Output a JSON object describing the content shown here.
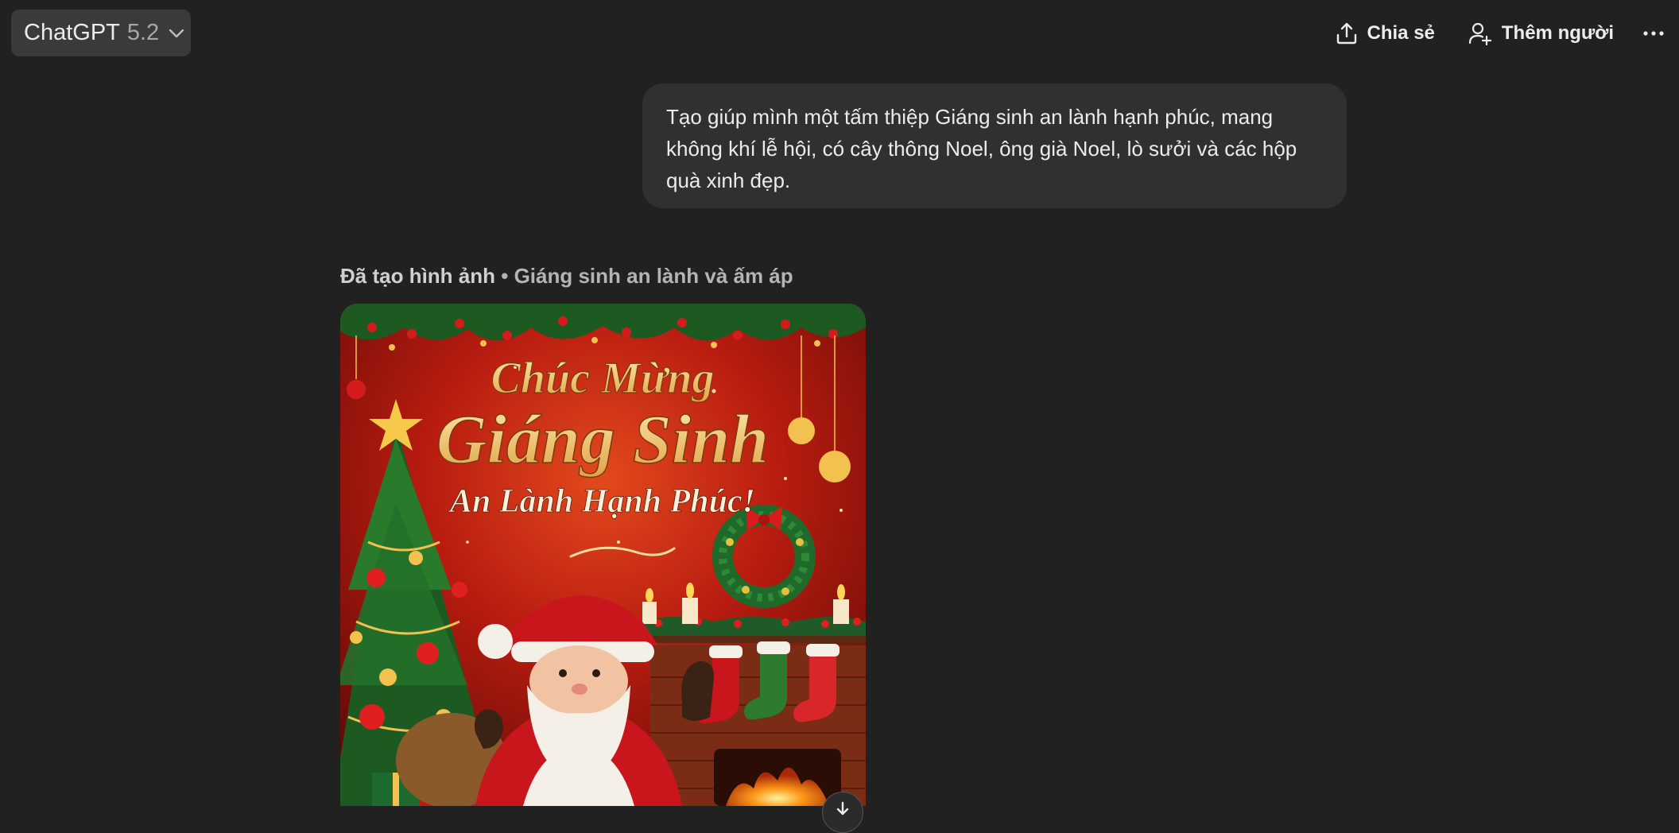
{
  "header": {
    "model_name": "ChatGPT",
    "model_version": "5.2",
    "share_label": "Chia sẻ",
    "add_people_label": "Thêm người"
  },
  "conversation": {
    "user_message": "Tạo giúp mình một tấm thiệp Giáng sinh an lành hạnh phúc, mang không khí lễ hội, có cây thông Noel, ông già Noel, lò sưởi và các hộp quà xinh đẹp.",
    "generated_label": "Đã tạo hình ảnh",
    "generated_separator": " • ",
    "generated_title": "Giáng sinh an lành và ấm áp"
  },
  "card_image": {
    "line1": "Chúc Mừng",
    "line2": "Giáng Sinh",
    "line3": "An Lành Hạnh Phúc!"
  },
  "icons": {
    "model": "chevron-down-icon",
    "share": "share-upload-icon",
    "add_people": "add-person-icon",
    "more": "more-horizontal-icon",
    "download": "download-icon"
  },
  "colors": {
    "background": "#212121",
    "bubble": "#303030",
    "model_button": "#3a3a3a",
    "card_red": "#b81c10",
    "gold": "#f3c46a"
  }
}
